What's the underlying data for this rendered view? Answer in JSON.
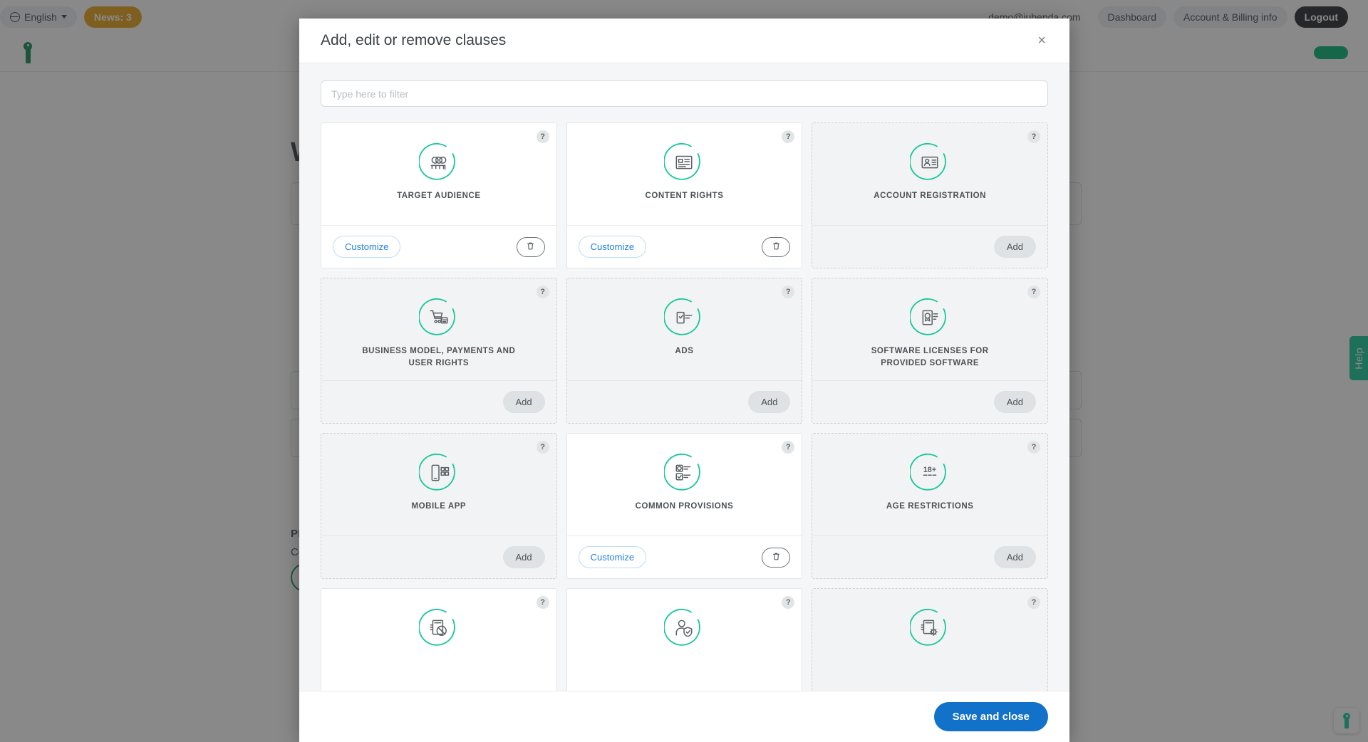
{
  "background": {
    "topbar": {
      "language": "English",
      "news_badge": "News: 3",
      "user_email": "demo@iubenda.com",
      "dashboard": "Dashboard",
      "account_billing": "Account & Billing info",
      "logout": "Logout"
    },
    "secondbar": {
      "action_label": ""
    },
    "headline": "W",
    "label_pr": "PR",
    "label_co": "Co",
    "help_tab": "Help"
  },
  "modal": {
    "title": "Add, edit or remove clauses",
    "close_label": "×",
    "filter_placeholder": "Type here to filter",
    "filter_value": "",
    "save_label": "Save and close",
    "help_badge": "?",
    "customize_label": "Customize",
    "add_label": "Add",
    "accent_blue": "#1271c9",
    "accent_green": "#16c79a",
    "link_blue": "#1f7fe0",
    "cards": [
      {
        "title": "TARGET AUDIENCE",
        "state": "active",
        "icon": "target-audience-icon"
      },
      {
        "title": "CONTENT RIGHTS",
        "state": "active",
        "icon": "content-rights-icon"
      },
      {
        "title": "ACCOUNT REGISTRATION",
        "state": "inactive",
        "icon": "account-registration-icon"
      },
      {
        "title": "BUSINESS MODEL, PAYMENTS AND USER RIGHTS",
        "state": "inactive",
        "icon": "business-model-icon"
      },
      {
        "title": "ADS",
        "state": "inactive",
        "icon": "ads-icon"
      },
      {
        "title": "SOFTWARE LICENSES FOR PROVIDED SOFTWARE",
        "state": "inactive",
        "icon": "software-license-icon"
      },
      {
        "title": "MOBILE APP",
        "state": "inactive",
        "icon": "mobile-app-icon"
      },
      {
        "title": "COMMON PROVISIONS",
        "state": "active",
        "icon": "common-provisions-icon"
      },
      {
        "title": "AGE RESTRICTIONS",
        "state": "inactive",
        "icon": "age-restrictions-icon"
      },
      {
        "title": "",
        "state": "active",
        "icon": "prohibited-content-icon"
      },
      {
        "title": "",
        "state": "active",
        "icon": "user-protection-icon"
      },
      {
        "title": "",
        "state": "inactive",
        "icon": "service-settings-icon"
      }
    ]
  }
}
